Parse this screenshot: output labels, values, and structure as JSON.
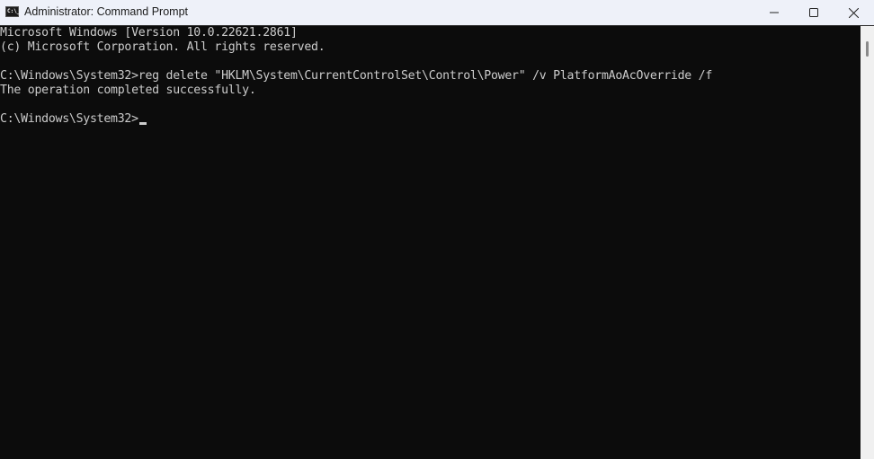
{
  "window": {
    "title": "Administrator: Command Prompt",
    "icon": "cmd-icon",
    "icon_text": "C:\\_",
    "controls": {
      "minimize": "minimize-icon",
      "maximize": "maximize-icon",
      "close": "close-icon"
    }
  },
  "console": {
    "lines": [
      "Microsoft Windows [Version 10.0.22621.2861]",
      "(c) Microsoft Corporation. All rights reserved.",
      "",
      "C:\\Windows\\System32>reg delete \"HKLM\\System\\CurrentControlSet\\Control\\Power\" /v PlatformAoAcOverride /f",
      "The operation completed successfully.",
      "",
      "C:\\Windows\\System32>"
    ],
    "colors": {
      "background": "#0c0c0c",
      "text": "#cccccc"
    }
  }
}
